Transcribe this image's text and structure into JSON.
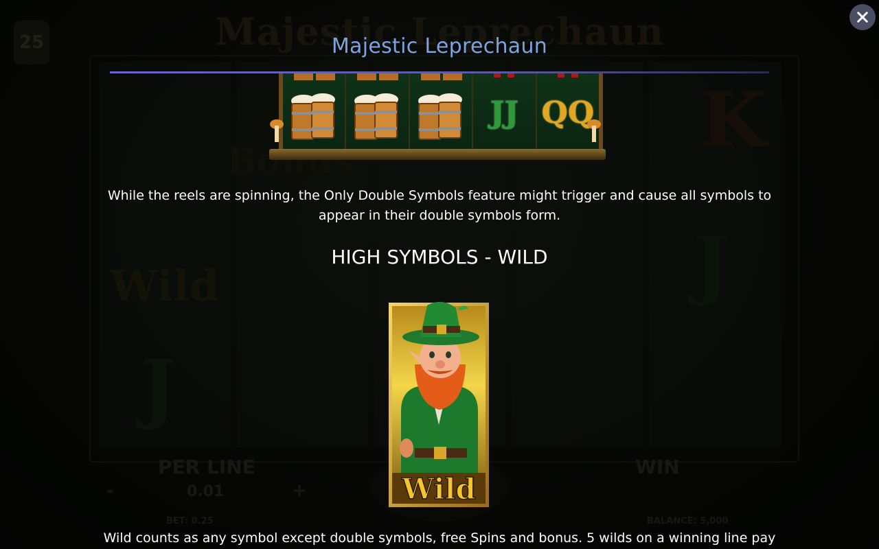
{
  "background": {
    "game_title": "Majestic Leprechaun",
    "lines_count": "25",
    "per_line_label": "PER LINE",
    "per_line_value": "0.01",
    "minus": "-",
    "plus": "+",
    "win_label": "WIN",
    "bet_text": "BET: 0.25",
    "balance_text": "BALANCE: 5,000",
    "ghost_wild": "Wild",
    "ghost_k": "K",
    "ghost_j": "J",
    "ghost_bonus": "Bonus"
  },
  "dialog": {
    "title": "Majestic Leprechaun",
    "close_icon": "close-icon",
    "reel_preview": {
      "symbols": [
        "mug",
        "mug",
        "mug",
        "J",
        "Q"
      ],
      "j_letter": "JJ",
      "q_letter": "QQ"
    },
    "description": "While the reels are spinning, the Only Double Symbols feature might trigger and cause all symbols to appear in their double symbols form.",
    "section_heading": "HIGH SYMBOLS - WILD",
    "wild_symbol_label": "Wild",
    "bottom_text": "Wild counts as any symbol except double symbols, free Spins and bonus. 5 wilds on a winning line pay"
  },
  "colors": {
    "title": "#7fa3e0",
    "rule": "#6a66c8",
    "gold": "#e1a622",
    "green": "#1f7a2e"
  }
}
